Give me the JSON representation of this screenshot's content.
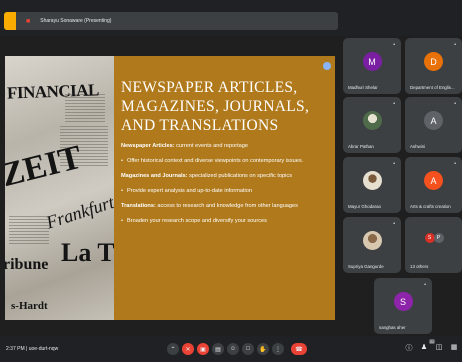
{
  "header": {
    "presenting_label": "Sharayu Sonaware (Presenting)",
    "stop_icon": "present-stop-icon"
  },
  "slide": {
    "photo_words": {
      "financial": "FINANCIAL",
      "zeit": "ZEIT",
      "frankfurter": "Frankfurte",
      "tribune": "ribune",
      "la_t": "La T",
      "hardt": "s-Hardt"
    },
    "title": "NEWSPAPER ARTICLES, MAGAZINES, JOURNALS, AND TRANSLATIONS",
    "sections": [
      {
        "head": "Newspaper Articles:",
        "head_rest": " current events and reportage",
        "bullet": "Offer historical context and diverse viewpoints on contemporary issues."
      },
      {
        "head": "Magazines and Journals:",
        "head_rest": " specialized publications on specific topics",
        "bullet": "Provide expert analysis and up-to-date information"
      },
      {
        "head": "Translations:",
        "head_rest": " access to research and knowledge from other languages",
        "bullet": "Broaden your research scope and diversify your sources"
      }
    ]
  },
  "participants": [
    {
      "name": "Madhuri Shelar",
      "initial": "M",
      "color": "#7b1fa2"
    },
    {
      "name": "Department of Englis...",
      "initial": "D",
      "color": "#e8710a"
    },
    {
      "name": "Abrar Pathan",
      "initial": "",
      "color": "#5f6b5f"
    },
    {
      "name": "Ashwini",
      "initial": "A",
      "color": "#5f6368"
    },
    {
      "name": "Mayur Ghodarao",
      "initial": "",
      "color": "#c8bfae"
    },
    {
      "name": "Arts & crafts creation",
      "initial": "A",
      "color": "#f4511e"
    },
    {
      "name": "Supriya Gangurde",
      "initial": "",
      "color": "#b99b76"
    },
    {
      "name": "13 others",
      "initial": "",
      "color": ""
    },
    {
      "name": "sanghas aher",
      "initial": "S",
      "color": "#8e24aa"
    }
  ],
  "others": {
    "a": "S",
    "b": "P",
    "a_color": "#d93025",
    "b_color": "#5f6368"
  },
  "footer": {
    "time": "2:37 PM",
    "separator": "|",
    "meeting_code": "uoe-durt-nqw",
    "participant_count": "21"
  }
}
